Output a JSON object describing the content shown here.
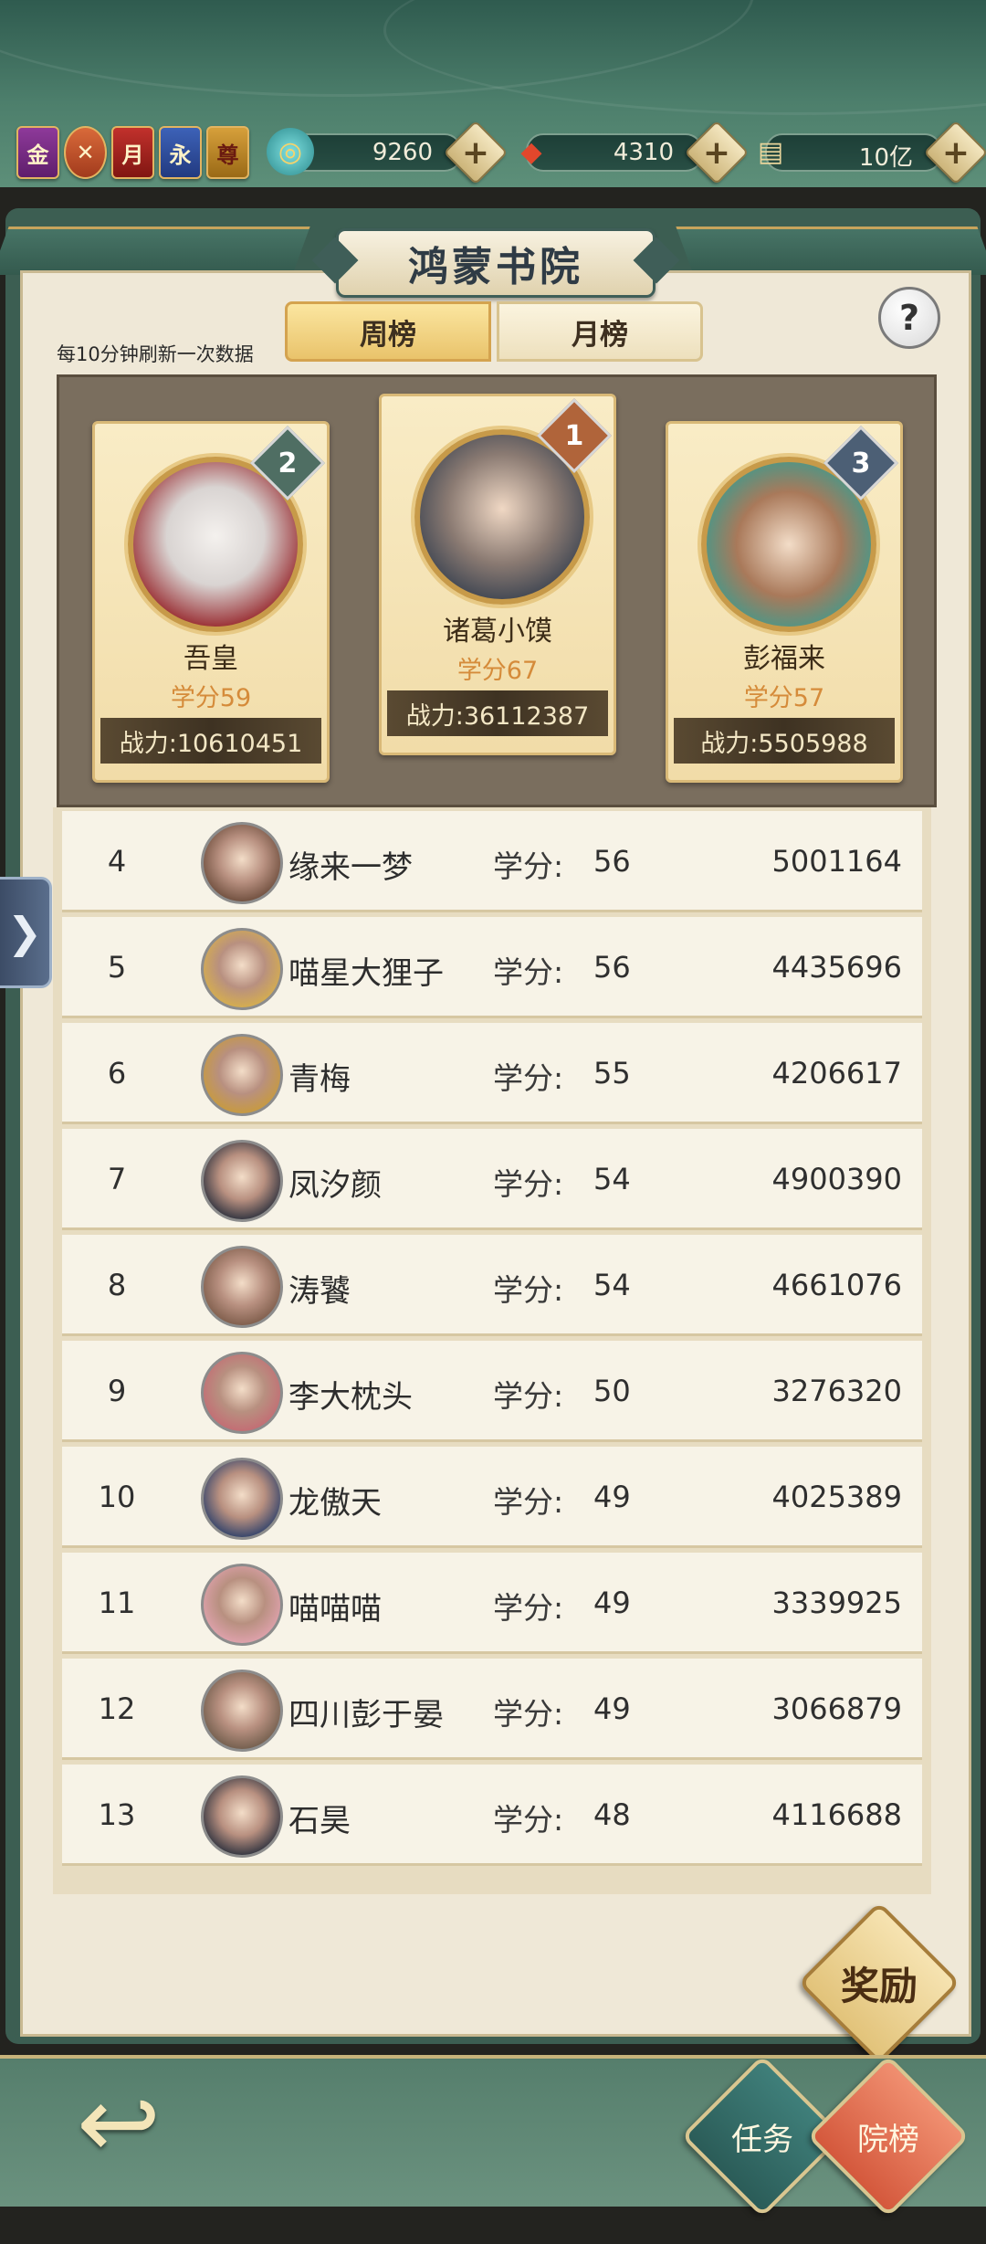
{
  "header": {
    "vip_icons": [
      "金",
      "",
      "月",
      "永",
      "尊"
    ],
    "resources": [
      {
        "icon": "jade-swirl-icon",
        "value": "9260"
      },
      {
        "icon": "red-crystal-icon",
        "value": "4310"
      },
      {
        "icon": "scroll-icon",
        "value": "10亿"
      }
    ]
  },
  "panel": {
    "title": "鸿蒙书院",
    "tabs": [
      {
        "label": "周榜",
        "active": true
      },
      {
        "label": "月榜",
        "active": false
      }
    ],
    "help": "?",
    "refresh_note": "每10分钟刷新一次数据"
  },
  "top3": [
    {
      "rank": "1",
      "name": "诸葛小馍",
      "score": "学分67",
      "power": "战力:36112387",
      "badge_color": "#b0643a"
    },
    {
      "rank": "2",
      "name": "吾皇",
      "score": "学分59",
      "power": "战力:10610451",
      "badge_color": "#4f6e63"
    },
    {
      "rank": "3",
      "name": "彭福来",
      "score": "学分57",
      "power": "战力:5505988",
      "badge_color": "#4c5f75"
    }
  ],
  "list": {
    "score_label": "学分:",
    "rows": [
      {
        "rank": "4",
        "name": "缘来一梦",
        "score": "56",
        "power": "5001164"
      },
      {
        "rank": "5",
        "name": "喵星大狸子",
        "score": "56",
        "power": "4435696"
      },
      {
        "rank": "6",
        "name": "青梅",
        "score": "55",
        "power": "4206617"
      },
      {
        "rank": "7",
        "name": "凤汐颜",
        "score": "54",
        "power": "4900390"
      },
      {
        "rank": "8",
        "name": "涛饕",
        "score": "54",
        "power": "4661076"
      },
      {
        "rank": "9",
        "name": "李大枕头",
        "score": "50",
        "power": "3276320"
      },
      {
        "rank": "10",
        "name": "龙傲天",
        "score": "49",
        "power": "4025389"
      },
      {
        "rank": "11",
        "name": "喵喵喵",
        "score": "49",
        "power": "3339925"
      },
      {
        "rank": "12",
        "name": "四川彭于晏",
        "score": "49",
        "power": "3066879"
      },
      {
        "rank": "13",
        "name": "石昊",
        "score": "48",
        "power": "4116688"
      }
    ]
  },
  "buttons": {
    "reward": "奖励",
    "task": "任务",
    "rank": "院榜",
    "side_tab": "❯",
    "back": "↩"
  }
}
